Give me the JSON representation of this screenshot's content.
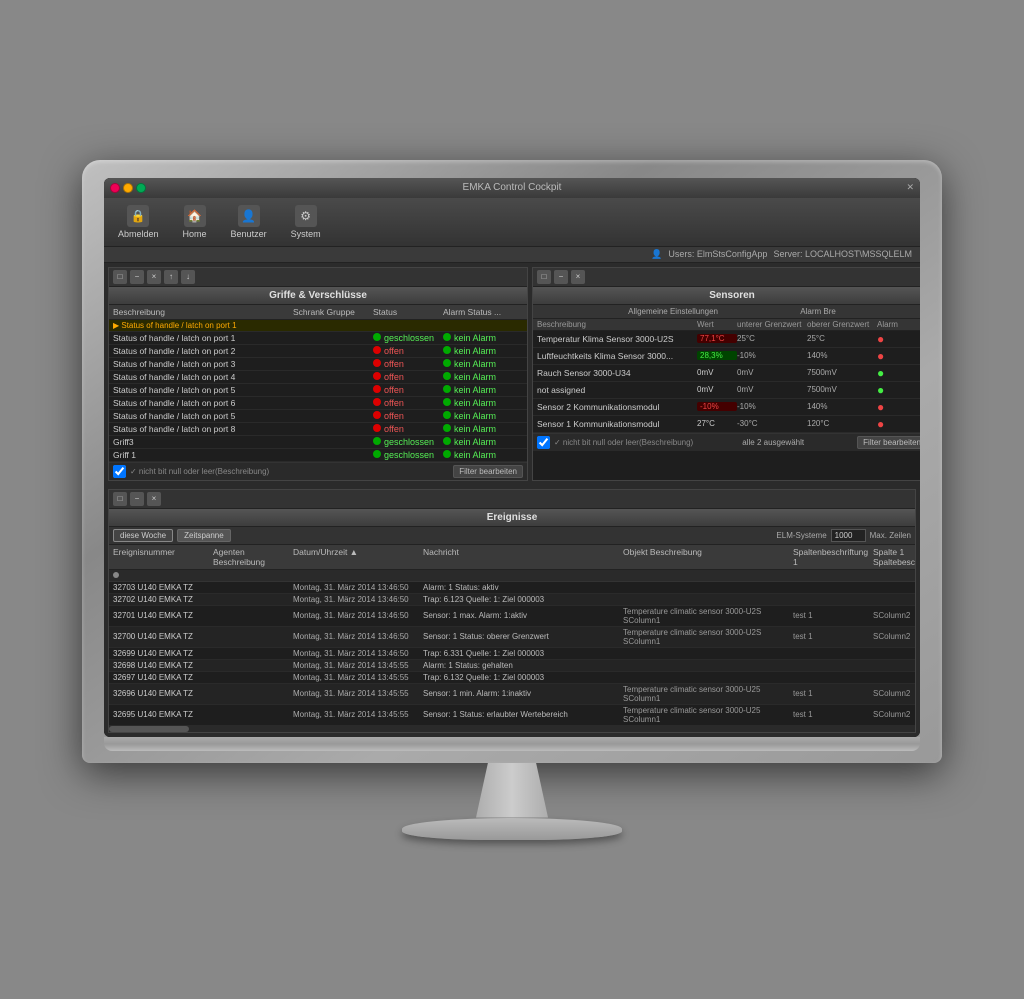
{
  "monitor": {
    "title": "EMKA Control Cockpit"
  },
  "titlebar": {
    "title": "EMKA Control Cockpit",
    "close_btn": "×",
    "min_btn": "−",
    "max_btn": "□"
  },
  "toolbar": {
    "items": [
      {
        "label": "Abmelden",
        "icon": "🔒"
      },
      {
        "label": "Home",
        "icon": "🏠"
      },
      {
        "label": "Benutzer",
        "icon": "👤"
      },
      {
        "label": "System",
        "icon": "⚙"
      }
    ]
  },
  "userbar": {
    "user_label": "Users: ElmStsConfigApp",
    "server_label": "Server: LOCALHOST\\MSSQLELM"
  },
  "griffe_panel": {
    "title": "Griffe & Verschlüsse",
    "columns": [
      "Beschreibung",
      "Schrank Gruppe",
      "Status",
      "Alarm Status"
    ],
    "rows": [
      {
        "desc": "Status of handle / latch on port 1",
        "gruppe": "",
        "status": "geschlossen",
        "status_type": "green",
        "alarm": "kein Alarm",
        "alarm_type": "green"
      },
      {
        "desc": "Status of handle / latch on port 2",
        "gruppe": "",
        "status": "offen",
        "status_type": "red",
        "alarm": "kein Alarm",
        "alarm_type": "green"
      },
      {
        "desc": "Status of handle / latch on port 3",
        "gruppe": "",
        "status": "offen",
        "status_type": "red",
        "alarm": "kein Alarm",
        "alarm_type": "green"
      },
      {
        "desc": "Status of handle / latch on port 4",
        "gruppe": "",
        "status": "offen",
        "status_type": "red",
        "alarm": "kein Alarm",
        "alarm_type": "green"
      },
      {
        "desc": "Status of handle / latch on port 5",
        "gruppe": "",
        "status": "offen",
        "status_type": "red",
        "alarm": "kein Alarm",
        "alarm_type": "green"
      },
      {
        "desc": "Status of handle / latch on port 6",
        "gruppe": "",
        "status": "offen",
        "status_type": "red",
        "alarm": "kein Alarm",
        "alarm_type": "green"
      },
      {
        "desc": "Status of handle / latch on port 5",
        "gruppe": "",
        "status": "offen",
        "status_type": "red",
        "alarm": "kein Alarm",
        "alarm_type": "green"
      },
      {
        "desc": "Status of handle / latch on port 8",
        "gruppe": "",
        "status": "offen",
        "status_type": "red",
        "alarm": "kein Alarm",
        "alarm_type": "green"
      },
      {
        "desc": "Griff3",
        "gruppe": "",
        "status": "geschlossen",
        "status_type": "green",
        "alarm": "kein Alarm",
        "alarm_type": "green"
      },
      {
        "desc": "Griff 1",
        "gruppe": "",
        "status": "geschlossen",
        "status_type": "green",
        "alarm": "kein Alarm",
        "alarm_type": "green"
      }
    ],
    "filter_label": "✓ nicht bit null oder leer(Beschreibung)",
    "filter_btn": "Filter bearbeiten"
  },
  "sensoren_panel": {
    "title": "Sensoren",
    "settings_label": "Allgemeine Einstellungen",
    "columns": [
      "Beschreibung",
      "Wert",
      "unterer Grenzwert",
      "oberer Grenzwert",
      "Alarm"
    ],
    "alarm_label": "Alarm Bre",
    "rows": [
      {
        "desc": "Temperatur Klima Sensor 3000-U2S",
        "wert": "77,1°C",
        "wert_type": "red",
        "unterer": "25°C",
        "oberer": "25°C",
        "alarm": "●",
        "alarm_color": "red"
      },
      {
        "desc": "Luftfeuchtkeits Klima Sensor 3000...",
        "wert": "28,3%",
        "wert_type": "green",
        "unterer": "-10%",
        "oberer": "140%",
        "alarm": "●",
        "alarm_color": "red"
      },
      {
        "desc": "Rauch Sensor 3000-U34",
        "wert": "0mV",
        "wert_type": "normal",
        "unterer": "0mV",
        "oberer": "7500mV",
        "alarm": "●",
        "alarm_color": "green"
      },
      {
        "desc": "not assigned",
        "wert": "0mV",
        "wert_type": "normal",
        "unterer": "0mV",
        "oberer": "7500mV",
        "alarm": "●",
        "alarm_color": "green"
      },
      {
        "desc": "Sensor 2 Kommunikationsmodul",
        "wert": "-10%",
        "wert_type": "red",
        "unterer": "-10%",
        "oberer": "140%",
        "alarm": "●",
        "alarm_color": "red"
      },
      {
        "desc": "Sensor 1 Kommunikationsmodul",
        "wert": "27°C",
        "wert_type": "normal",
        "unterer": "-30°C",
        "oberer": "120°C",
        "alarm": "●",
        "alarm_color": "red"
      }
    ],
    "filter_label": "✓ nicht bit null oder leer(Beschreibung)",
    "filter_btn": "Filter bearbeiten",
    "sel_label": "alle 2 ausgewählt"
  },
  "ereignisse_panel": {
    "title": "Ereignisse",
    "columns": [
      "Ereignisnummer",
      "Agenten Beschreibung",
      "Datum/Uhrzeit",
      "Nachricht",
      "Objekt Beschreibung",
      "Spaltenbeschriftung 1",
      "Spalte 1",
      "Spaltebesc"
    ],
    "rows": [
      {
        "nr": "32703 U140 EMKA TZ",
        "datum": "Montag, 31. März 2014 13:46:50",
        "msg": "Alarm: 1 Status: aktiv",
        "obj": "",
        "sp1": "",
        "sp2": ""
      },
      {
        "nr": "32702 U140 EMKA TZ",
        "datum": "Montag, 31. März 2014 13:46:50",
        "msg": "Trap: 6.123 Quelle: 1: Ziel 000003",
        "obj": "",
        "sp1": "",
        "sp2": ""
      },
      {
        "nr": "32701 U140 EMKA TZ",
        "datum": "Montag, 31. März 2014 13:46:50",
        "msg": "Sensor: 1 max. Alarm: 1:aktiv",
        "obj": "Temperature climatic sensor 3000-U2S SColumn1",
        "sp1": "test 1",
        "sp2": "SColumn2"
      },
      {
        "nr": "32700 U140 EMKA TZ",
        "datum": "Montag, 31. März 2014 13:46:50",
        "msg": "Sensor: 1 Status: oberer Grenzwert",
        "obj": "Temperature climatic sensor 3000-U2S SColumn1",
        "sp1": "test 1",
        "sp2": "SColumn2"
      },
      {
        "nr": "32699 U140 EMKA TZ",
        "datum": "Montag, 31. März 2014 13:46:50",
        "msg": "Trap: 6.331 Quelle: 1: Ziel 000003",
        "obj": "",
        "sp1": "",
        "sp2": ""
      },
      {
        "nr": "32698 U140 EMKA TZ",
        "datum": "Montag, 31. März 2014 13:45:55",
        "msg": "Alarm: 1 Status: gehalten",
        "obj": "",
        "sp1": "",
        "sp2": ""
      },
      {
        "nr": "32697 U140 EMKA TZ",
        "datum": "Montag, 31. März 2014 13:45:55",
        "msg": "Trap: 6.132 Quelle: 1: Ziel 000003",
        "obj": "",
        "sp1": "",
        "sp2": ""
      },
      {
        "nr": "32696 U140 EMKA TZ",
        "datum": "Montag, 31. März 2014 13:45:55",
        "msg": "Sensor: 1 min. Alarm: 1:inaktiv",
        "obj": "Temperature climatic sensor 3000-U25 SColumn1",
        "sp1": "test 1",
        "sp2": "SColumn2"
      },
      {
        "nr": "32695 U140 EMKA TZ",
        "datum": "Montag, 31. März 2014 13:45:55",
        "msg": "Sensor: 1 Status: erlaubter Wertebereich",
        "obj": "Temperature climatic sensor 3000-U25 SColumn1",
        "sp1": "test 1",
        "sp2": "SColumn2"
      }
    ],
    "period_this_week": "diese Woche",
    "period_timespan": "Zeitspanne",
    "elm_label": "ELM-Systeme",
    "elm_value": "1000",
    "max_label": "Max. Zeilen"
  }
}
